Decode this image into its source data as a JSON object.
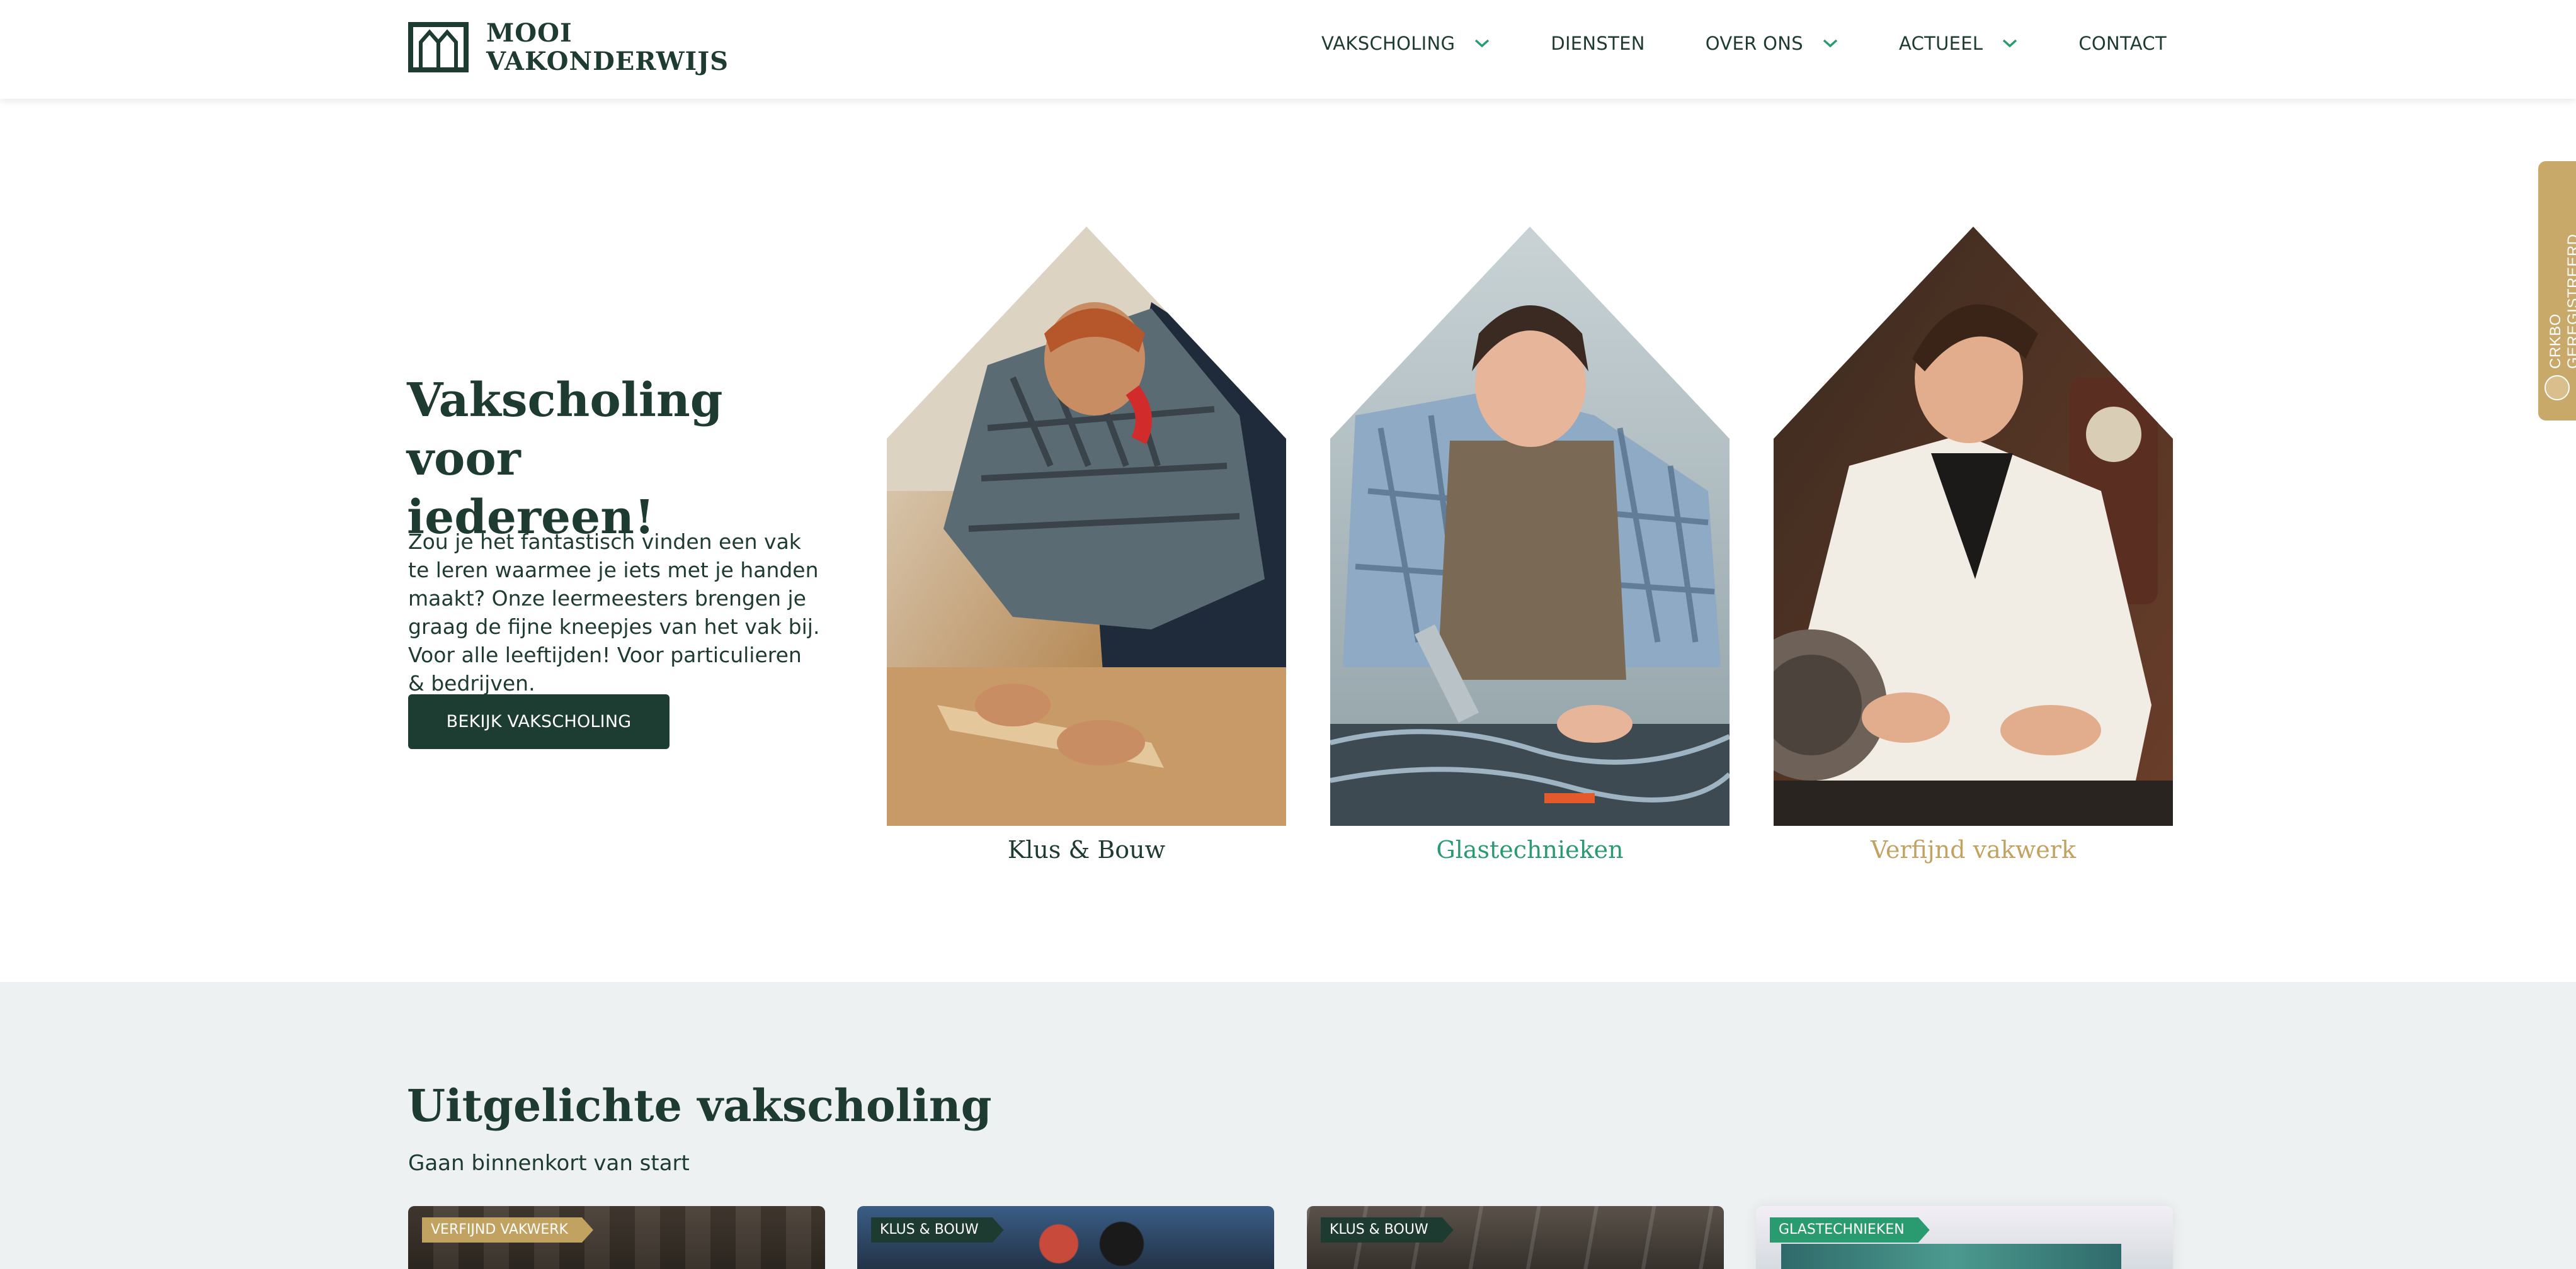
{
  "header": {
    "logo": {
      "line1": "MOOI",
      "line2": "VAKONDERWIJS"
    },
    "nav": [
      {
        "label": "VAKSCHOLING",
        "has_dropdown": true
      },
      {
        "label": "DIENSTEN",
        "has_dropdown": false
      },
      {
        "label": "OVER ONS",
        "has_dropdown": true
      },
      {
        "label": "ACTUEEL",
        "has_dropdown": true
      },
      {
        "label": "CONTACT",
        "has_dropdown": false
      }
    ]
  },
  "side_tab": {
    "label": "CRKBO GEREGISTREERD",
    "icon": "crkbo-seal-icon"
  },
  "hero": {
    "title_line1": "Vakscholing voor",
    "title_line2": "iedereen!",
    "text": "Zou je het fantastisch vinden een vak te leren waarmee je iets met je handen maakt? Onze leermeesters brengen je graag de fijne kneepjes van het vak bij. Voor alle leeftijden! Voor particulieren & bedrijven.",
    "button_label": "BEKIJK VAKSCHOLING"
  },
  "categories": [
    {
      "label": "Klus & Bouw",
      "color": "#1d3b30",
      "image": "woodworker-photo"
    },
    {
      "label": "Glastechnieken",
      "color": "#2a9a70",
      "image": "glass-artisan-photo"
    },
    {
      "label": "Verfijnd vakwerk",
      "color": "#c2a261",
      "image": "clockmaker-photo"
    }
  ],
  "featured": {
    "title": "Uitgelichte vakscholing",
    "subtitle": "Gaan binnenkort van start",
    "cards": [
      {
        "tag": "VERFIJND VAKWERK",
        "tag_color": "#c2a261"
      },
      {
        "tag": "KLUS & BOUW",
        "tag_color": "#1d3b30"
      },
      {
        "tag": "KLUS & BOUW",
        "tag_color": "#1d3b30"
      },
      {
        "tag": "GLASTECHNIEKEN",
        "tag_color": "#2a9a70"
      }
    ]
  },
  "colors": {
    "primary": "#1d3b30",
    "accent_green": "#2a9a70",
    "accent_gold": "#c2a261",
    "section_bg": "#eef1f2"
  }
}
